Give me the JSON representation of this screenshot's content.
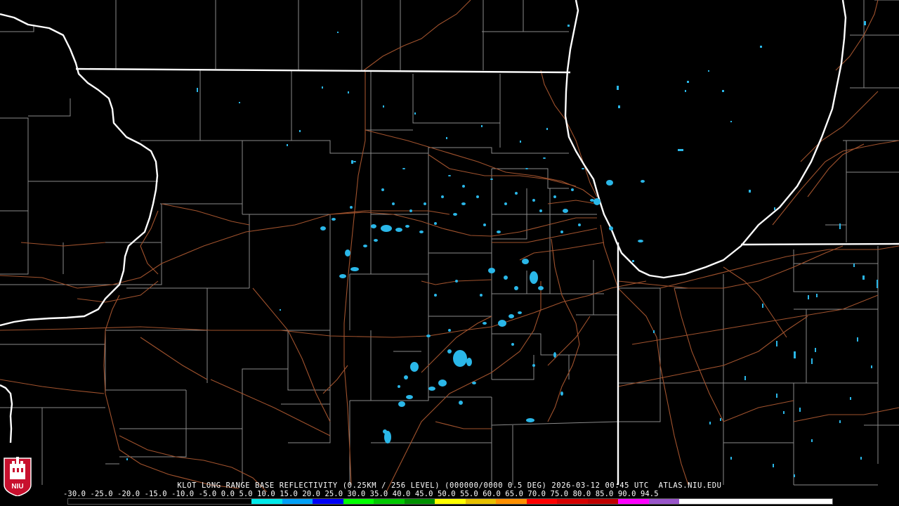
{
  "caption": "KLOT LONG RANGE BASE REFLECTIVITY (0.25KM / 256 LEVEL) (000000/0000 0.5 DEG) 2026-03-12 00:45 UTC  ATLAS.NIU.EDU",
  "scale_labels": [
    "-30.0",
    "-25.0",
    "-20.0",
    "-15.0",
    "-10.0",
    "-5.0",
    "0.0",
    "5.0",
    "10.0",
    "15.0",
    "20.0",
    "25.0",
    "30.0",
    "35.0",
    "40.0",
    "45.0",
    "50.0",
    "55.0",
    "60.0",
    "65.0",
    "70.0",
    "75.0",
    "80.0",
    "85.0",
    "90.0",
    "94.5"
  ],
  "colorbar_colors": [
    "#000000",
    "#000000",
    "#000000",
    "#000000",
    "#000000",
    "#000000",
    "#00e8e8",
    "#01a0f6",
    "#0000f6",
    "#00ff00",
    "#00c800",
    "#009000",
    "#ffff00",
    "#e7c000",
    "#ff9000",
    "#ff0000",
    "#d60000",
    "#c00000",
    "#ff00ff",
    "#9955c9",
    "#ffffff",
    "#ffffff",
    "#ffffff",
    "#ffffff",
    "#ffffff"
  ],
  "logo_text": "NIU",
  "map_colors": {
    "background": "#000000",
    "state_border": "#ffffff",
    "county_border": "#808080",
    "highway": "#a0522d",
    "echo": "#2ab7e8"
  }
}
